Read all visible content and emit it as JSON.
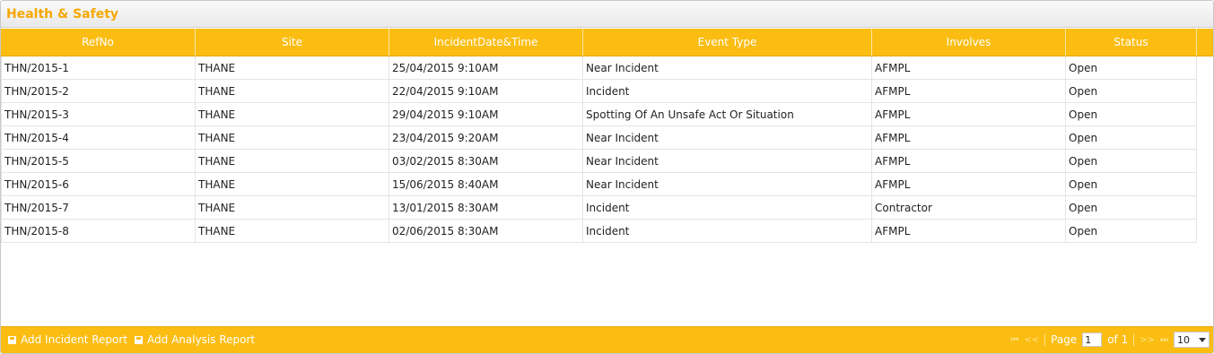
{
  "panel": {
    "title": "Health & Safety"
  },
  "grid": {
    "columns": [
      "RefNo",
      "Site",
      "IncidentDate&Time",
      "Event Type",
      "Involves",
      "Status"
    ],
    "rows": [
      [
        "THN/2015-1",
        "THANE",
        "25/04/2015  9:10AM",
        "Near Incident",
        "AFMPL",
        "Open"
      ],
      [
        "THN/2015-2",
        "THANE",
        "22/04/2015  9:10AM",
        "Incident",
        "AFMPL",
        "Open"
      ],
      [
        "THN/2015-3",
        "THANE",
        "29/04/2015  9:10AM",
        "Spotting Of An Unsafe Act Or Situation",
        "AFMPL",
        "Open"
      ],
      [
        "THN/2015-4",
        "THANE",
        "23/04/2015  9:20AM",
        "Near Incident",
        "AFMPL",
        "Open"
      ],
      [
        "THN/2015-5",
        "THANE",
        "03/02/2015  8:30AM",
        "Near Incident",
        "AFMPL",
        "Open"
      ],
      [
        "THN/2015-6",
        "THANE",
        "15/06/2015  8:40AM",
        "Near Incident",
        "AFMPL",
        "Open"
      ],
      [
        "THN/2015-7",
        "THANE",
        "13/01/2015  8:30AM",
        "Incident",
        "Contractor",
        "Open"
      ],
      [
        "THN/2015-8",
        "THANE",
        "02/06/2015  8:30AM",
        "Incident",
        "AFMPL",
        "Open"
      ]
    ]
  },
  "footer": {
    "actions": [
      {
        "label": "Add Incident Report",
        "icon": "floppy-icon"
      },
      {
        "label": "Add Analysis Report",
        "icon": "floppy-icon"
      }
    ],
    "pager": {
      "first": "⏮",
      "prev": "<<",
      "page_label": "Page",
      "page_value": "1",
      "of_label": "of 1",
      "next": ">>",
      "last": "⏭",
      "rows_per_page": "10"
    }
  },
  "colors": {
    "accent": "#fbbd12",
    "title": "#f5a800"
  }
}
